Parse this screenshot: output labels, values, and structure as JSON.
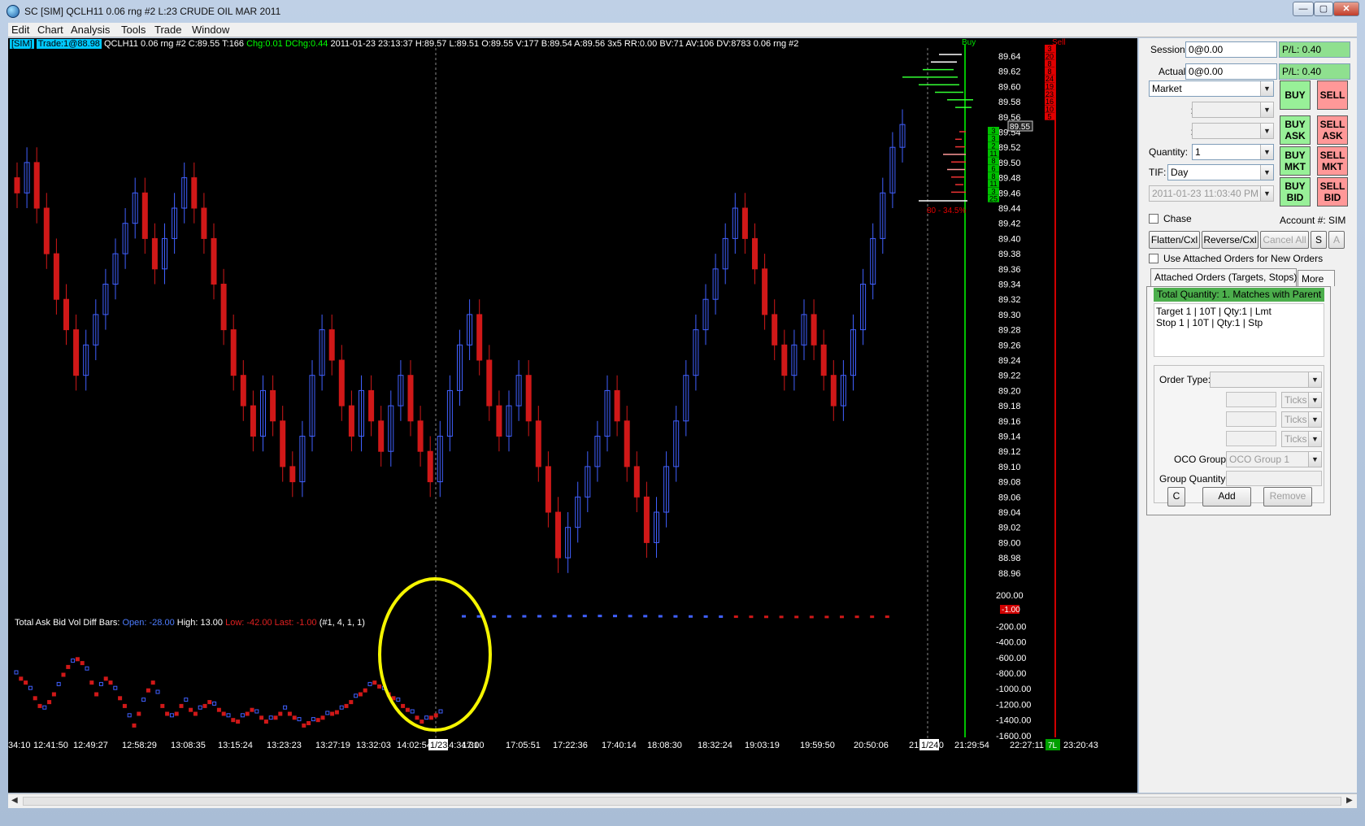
{
  "window": {
    "title": "SC [SIM] QCLH11  0.06 rng  #2  L:23  CRUDE OIL MAR 2011",
    "min": "—",
    "max": "▢",
    "close": "✕"
  },
  "menu": [
    "Edit",
    "Chart",
    "Analysis",
    "Tools",
    "Trade",
    "Window"
  ],
  "info_line": {
    "sim": "[SIM]",
    "trade": "Trade:1@88.98",
    "symbol": "QCLH11  0.06 rng  #2  C:89.55  T:166",
    "chg": "Chg:0.01",
    "dchg": "DChg:0.44",
    "rest": "2011-01-23  23:13:37  H:89.57  L:89.51  O:89.55  V:177  B:89.54  A:89.56  3x5  RR:0.00  BV:71  AV:106  DV:8783  0.06 rng  #2"
  },
  "indicator_label": {
    "name": "Total Ask Bid Vol Diff Bars:",
    "open": "Open: -28.00",
    "high": "High: 13.00",
    "low": "Low: -42.00",
    "last": "Last: -1.00",
    "params": "(#1, 4, 1, 1)"
  },
  "dom": {
    "buy_label": "Buy",
    "sell_label": "Sell",
    "last_price_tag": "89.55",
    "pct_label": "80 - 34.5%",
    "sell_sizes": [
      "3",
      "20",
      "8",
      "8",
      "24",
      "19",
      "23",
      "16",
      "10",
      "5"
    ],
    "buy_sizes": [
      "3",
      "3",
      "2",
      "11",
      "8",
      "6",
      "8",
      "11",
      "3",
      "25"
    ]
  },
  "indicator_last_tag": "-1.00",
  "corner_tag": "7L",
  "date_marks": [
    "1/23",
    "1/24"
  ],
  "chart_data": {
    "type": "candlestick",
    "price_axis": [
      "89.64",
      "89.62",
      "89.60",
      "89.58",
      "89.56",
      "89.54",
      "89.52",
      "89.50",
      "89.48",
      "89.46",
      "89.44",
      "89.42",
      "89.40",
      "89.38",
      "89.36",
      "89.34",
      "89.32",
      "89.30",
      "89.28",
      "89.26",
      "89.24",
      "89.22",
      "89.20",
      "89.18",
      "89.16",
      "89.14",
      "89.12",
      "89.10",
      "89.08",
      "89.06",
      "89.04",
      "89.02",
      "89.00",
      "88.98",
      "88.96"
    ],
    "indicator_axis": [
      "200.00",
      "-200.00",
      "-400.00",
      "-600.00",
      "-800.00",
      "-1000.00",
      "-1200.00",
      "-1400.00",
      "-1600.00"
    ],
    "time_axis": [
      "34:10",
      "12:41:50",
      "12:49:27",
      "12:58:29",
      "13:08:35",
      "13:15:24",
      "13:23:23",
      "13:27:19",
      "13:32:03",
      "14:02:54",
      "14:34:31",
      "17:00",
      "17:05:51",
      "17:22:36",
      "17:40:14",
      "18:08:30",
      "18:32:24",
      "19:03:19",
      "19:59:50",
      "20:50:06",
      "21:18:30",
      "21:29:54",
      "22:27:11",
      "23:20:43"
    ],
    "close_series": [
      89.46,
      89.5,
      89.44,
      89.38,
      89.32,
      89.28,
      89.22,
      89.26,
      89.3,
      89.34,
      89.38,
      89.42,
      89.46,
      89.4,
      89.36,
      89.4,
      89.44,
      89.48,
      89.44,
      89.4,
      89.34,
      89.28,
      89.22,
      89.18,
      89.14,
      89.2,
      89.16,
      89.1,
      89.08,
      89.14,
      89.22,
      89.28,
      89.24,
      89.18,
      89.14,
      89.2,
      89.16,
      89.12,
      89.18,
      89.22,
      89.16,
      89.12,
      89.08,
      89.14,
      89.2,
      89.26,
      89.3,
      89.24,
      89.18,
      89.14,
      89.18,
      89.22,
      89.16,
      89.1,
      89.04,
      88.98,
      89.02,
      89.06,
      89.1,
      89.14,
      89.2,
      89.16,
      89.1,
      89.06,
      89.0,
      89.04,
      89.1,
      89.16,
      89.22,
      89.28,
      89.32,
      89.36,
      89.4,
      89.44,
      89.4,
      89.36,
      89.3,
      89.26,
      89.22,
      89.26,
      89.3,
      89.26,
      89.22,
      89.18,
      89.22,
      89.28,
      89.34,
      89.4,
      89.46,
      89.52,
      89.55
    ],
    "indicator_series": [
      -800,
      -850,
      -900,
      -1000,
      -1100,
      -1200,
      -1250,
      -1150,
      -1050,
      -950,
      -800,
      -700,
      -650,
      -600,
      -650,
      -750,
      -900,
      -1050,
      -950,
      -850,
      -900,
      -1000,
      -1100,
      -1200,
      -1350,
      -1450,
      -1300,
      -1150,
      -1000,
      -900,
      -1050,
      -1200,
      -1300,
      -1350,
      -1300,
      -1200,
      -1150,
      -1250,
      -1300,
      -1250,
      -1200,
      -1150,
      -1200,
      -1250,
      -1300,
      -1350,
      -1380,
      -1400,
      -1350,
      -1300,
      -1250,
      -1300,
      -1350,
      -1400,
      -1380,
      -1350,
      -1300,
      -1250,
      -1300,
      -1350,
      -1400,
      -1450,
      -1420,
      -1400,
      -1380,
      -1350,
      -1320,
      -1300,
      -1280,
      -1250,
      -1200,
      -1150,
      -1100,
      -1050,
      -1000,
      -950,
      -900,
      -950,
      -1000,
      -1050,
      -1100,
      -1150,
      -1200,
      -1250,
      -1300,
      -1350,
      -1400,
      -1380,
      -1350,
      -1320,
      -1300
    ],
    "indicator_series_2": [
      80,
      50,
      40,
      60,
      80,
      100,
      120,
      140,
      160,
      170,
      160,
      140,
      120,
      90,
      60,
      40,
      20,
      0,
      -20,
      -40,
      -60,
      -80,
      -90,
      -100,
      -90,
      -70,
      -50,
      -40,
      -30
    ]
  },
  "panel": {
    "session_label": "Session",
    "session_value": "0@0.00",
    "session_pl": "P/L: 0.40",
    "actual_label": "Actual",
    "actual_value": "0@0.00",
    "actual_pl": "P/L: 0.40",
    "order_type": "Market",
    "buy": "BUY",
    "sell": "SELL",
    "buy_ask": "BUY\nASK",
    "sell_ask": "SELL\nASK",
    "buy_mkt": "BUY\nMKT",
    "sell_mkt": "SELL\nMKT",
    "buy_bid": "BUY\nBID",
    "sell_bid": "SELL\nBID",
    "quantity_label": "Quantity:",
    "quantity_value": "1",
    "tif_label": "TIF:",
    "tif_value": "Day",
    "datetime_value": "2011-01-23 11:03:40 PM",
    "chase_label": "Chase",
    "account_label": "Account #: SIM",
    "flatten": "Flatten/Cxl",
    "reverse": "Reverse/Cxl",
    "cancel_all": "Cancel All",
    "s": "S",
    "a": "A",
    "use_attached": "Use Attached Orders for New Orders",
    "tab_attached": "Attached Orders (Targets, Stops)",
    "tab_more": "More",
    "total_qty": "Total Quantity: 1. Matches with Parent",
    "orders": [
      "Target 1 | 10T | Qty:1 | Lmt",
      "Stop 1 | 10T | Qty:1 | Stp"
    ],
    "ordtype_label": "Order Type:",
    "ticks": "Ticks",
    "oco_label": "OCO Group:",
    "oco_value": "OCO Group 1",
    "group_qty_label": "Group Quantity:",
    "c": "C",
    "add": "Add",
    "remove": "Remove"
  }
}
